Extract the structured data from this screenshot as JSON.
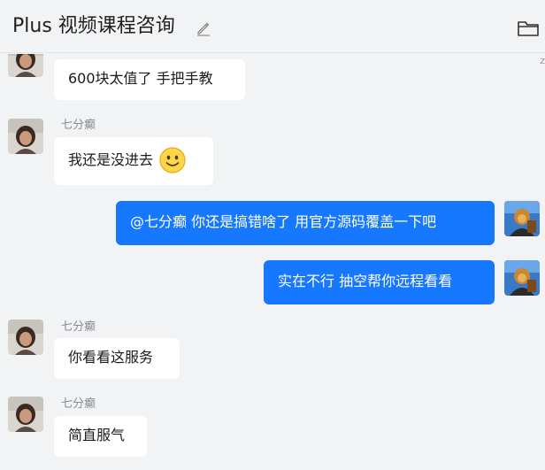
{
  "header": {
    "title": "Plus 视频课程咨询",
    "edit_icon": "edit-pencil-icon",
    "folder_icon": "folder-icon"
  },
  "stray_mark": "z",
  "messages": [
    {
      "direction": "in",
      "sender": "",
      "text": "600块太值了 手把手教"
    },
    {
      "direction": "in",
      "sender": "七分癫",
      "text": "我还是没进去",
      "emoji": "smile-emoji-icon"
    },
    {
      "direction": "out",
      "text": "@七分癫 你还是搞错啥了 用官方源码覆盖一下吧"
    },
    {
      "direction": "out",
      "text": "实在不行 抽空帮你远程看看"
    },
    {
      "direction": "in",
      "sender": "七分癫",
      "text": "你看看这服务"
    },
    {
      "direction": "in",
      "sender": "七分癫",
      "text": "简直服气"
    }
  ],
  "colors": {
    "background": "#f2f3f5",
    "incoming_bubble": "#ffffff",
    "outgoing_bubble": "#1677ff",
    "sender_name": "#888b90"
  }
}
